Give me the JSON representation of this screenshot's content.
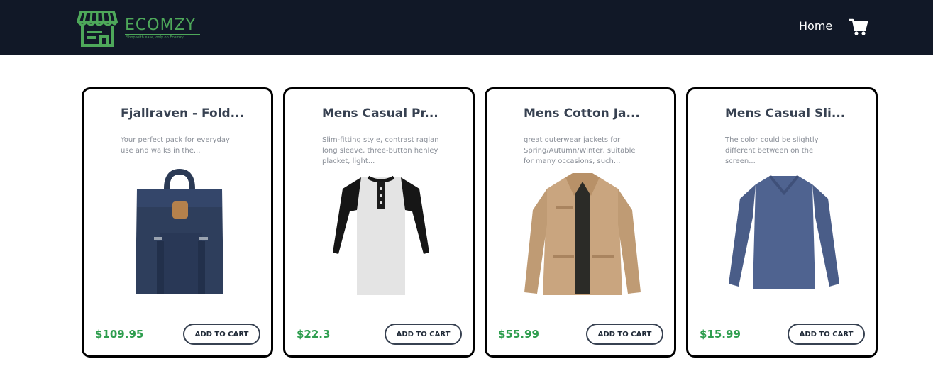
{
  "brand": {
    "name": "ECOMZY",
    "tagline": "Shop with ease, only on Ecomzy.",
    "color": "#4ea85a"
  },
  "nav": {
    "home_label": "Home",
    "cart_icon": "shopping-cart-icon"
  },
  "colors": {
    "navbar_bg": "#111827",
    "price": "#2f9e4f",
    "title": "#374151"
  },
  "products": [
    {
      "title": "Fjallraven - Fold...",
      "description": "Your perfect pack for everyday use and walks in the...",
      "price": "$109.95",
      "button_label": "ADD TO CART",
      "image": "backpack-image"
    },
    {
      "title": "Mens Casual Pr...",
      "description": "Slim-fitting style, contrast raglan long sleeve, three-button henley placket, light...",
      "price": "$22.3",
      "button_label": "ADD TO CART",
      "image": "raglan-tshirt-image"
    },
    {
      "title": "Mens Cotton Ja...",
      "description": "great outerwear jackets for Spring/Autumn/Winter, suitable for many occasions, such...",
      "price": "$55.99",
      "button_label": "ADD TO CART",
      "image": "cotton-jacket-image"
    },
    {
      "title": "Mens Casual Sli...",
      "description": "The color could be slightly different between on the screen...",
      "price": "$15.99",
      "button_label": "ADD TO CART",
      "image": "slim-fit-shirt-image"
    }
  ]
}
